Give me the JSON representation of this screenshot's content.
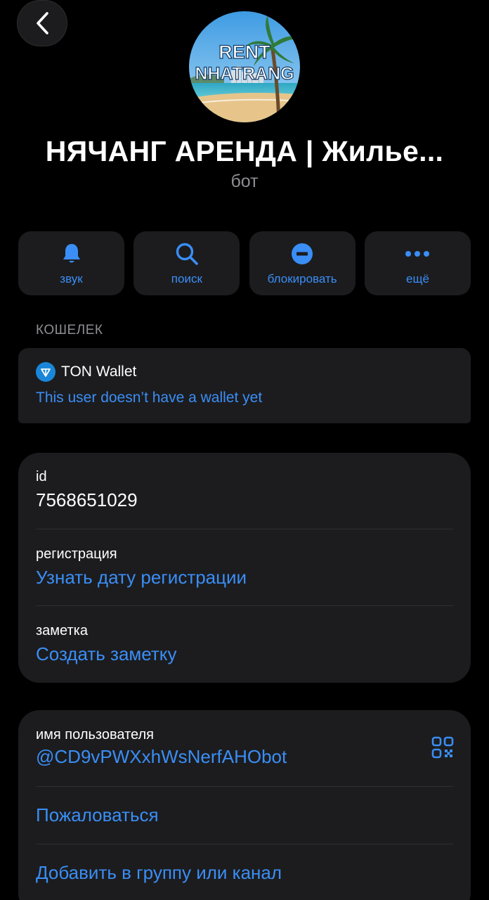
{
  "header": {
    "avatar_text_line1": "RENT",
    "avatar_text_line2": "NHATRANG",
    "title": "НЯЧАНГ АРЕНДА | Жилье...",
    "subtitle": "бот"
  },
  "actions": [
    {
      "label": "звук",
      "icon": "bell-icon"
    },
    {
      "label": "поиск",
      "icon": "search-icon"
    },
    {
      "label": "блокировать",
      "icon": "block-icon"
    },
    {
      "label": "ещё",
      "icon": "more-icon"
    }
  ],
  "wallet": {
    "section_label": "КОШЕЛЕК",
    "name": "TON Wallet",
    "status": "This user doesn’t have a wallet yet"
  },
  "info": {
    "id_label": "id",
    "id_value": "7568651029",
    "registration_label": "регистрация",
    "registration_link": "Узнать дату регистрации",
    "note_label": "заметка",
    "note_link": "Создать заметку"
  },
  "user": {
    "username_label": "имя пользователя",
    "username_value": "@CD9vPWXxhWsNerfAHObot",
    "report_link": "Пожаловаться",
    "add_link": "Добавить в группу или канал"
  },
  "colors": {
    "accent": "#3a8ef6",
    "background": "#000000",
    "card": "#1c1c1e",
    "secondary_text": "#8d8d93"
  }
}
